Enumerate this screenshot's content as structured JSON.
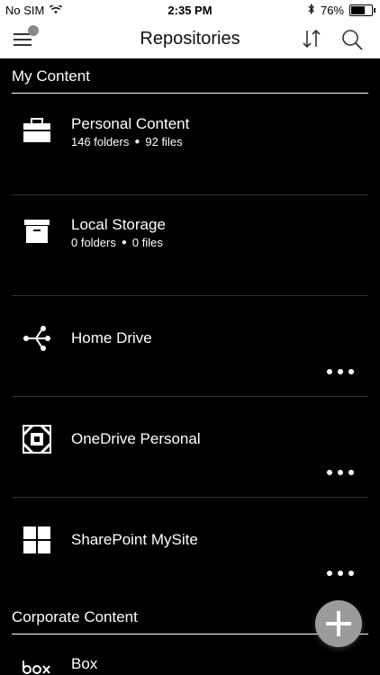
{
  "status": {
    "carrier": "No SIM",
    "time": "2:35 PM",
    "battery_text": "76%",
    "battery_level": 0.76
  },
  "nav": {
    "title": "Repositories"
  },
  "sections": {
    "my_content": "My Content",
    "corporate_content": "Corporate Content"
  },
  "rows": [
    {
      "title": "Personal Content",
      "folders": "146 folders",
      "files": "92 files",
      "icon": "briefcase-icon"
    },
    {
      "title": "Local Storage",
      "folders": "0 folders",
      "files": "0 files",
      "icon": "archive-box-icon"
    },
    {
      "title": "Home Drive",
      "icon": "network-share-icon"
    },
    {
      "title": "OneDrive Personal",
      "icon": "onedrive-icon"
    },
    {
      "title": "SharePoint MySite",
      "icon": "sharepoint-grid-icon"
    },
    {
      "title": "Box",
      "icon": "box-logo-icon"
    }
  ]
}
